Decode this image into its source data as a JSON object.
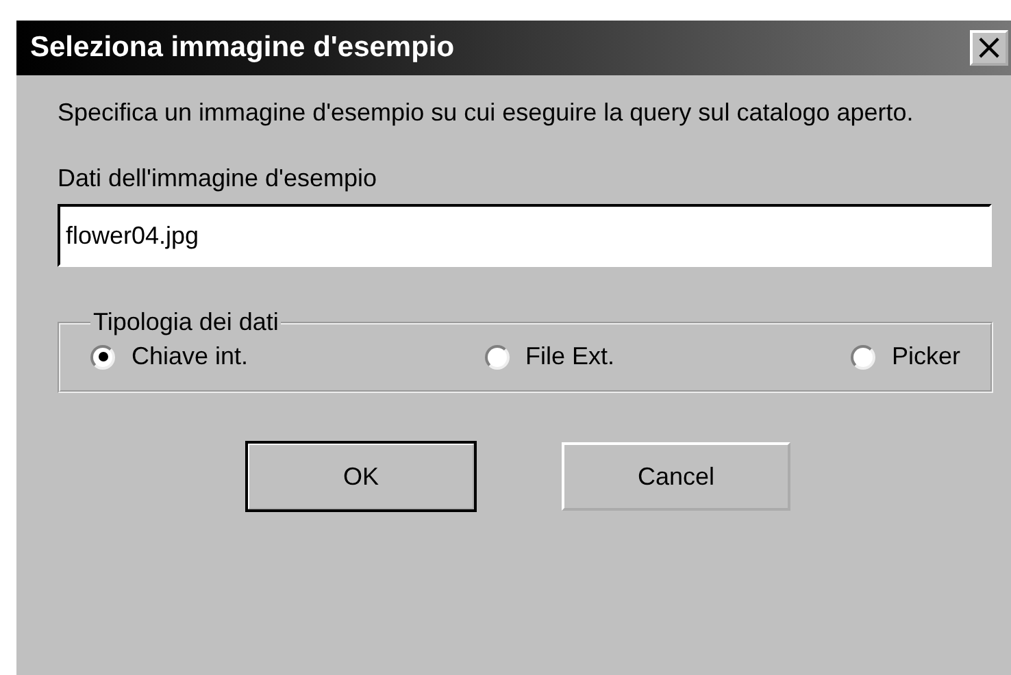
{
  "window": {
    "title": "Seleziona immagine d'esempio",
    "close": "×"
  },
  "description": "Specifica un immagine d'esempio su cui eseguire la query sul catalogo aperto.",
  "field": {
    "label": "Dati dell'immagine d'esempio",
    "value": "flower04.jpg"
  },
  "group": {
    "title": "Tipologia dei dati",
    "options": [
      {
        "label": "Chiave int.",
        "selected": true
      },
      {
        "label": "File Ext.",
        "selected": false
      },
      {
        "label": "Picker",
        "selected": false
      }
    ]
  },
  "buttons": [
    {
      "label": "OK",
      "default": true
    },
    {
      "label": "Cancel",
      "default": false
    }
  ]
}
